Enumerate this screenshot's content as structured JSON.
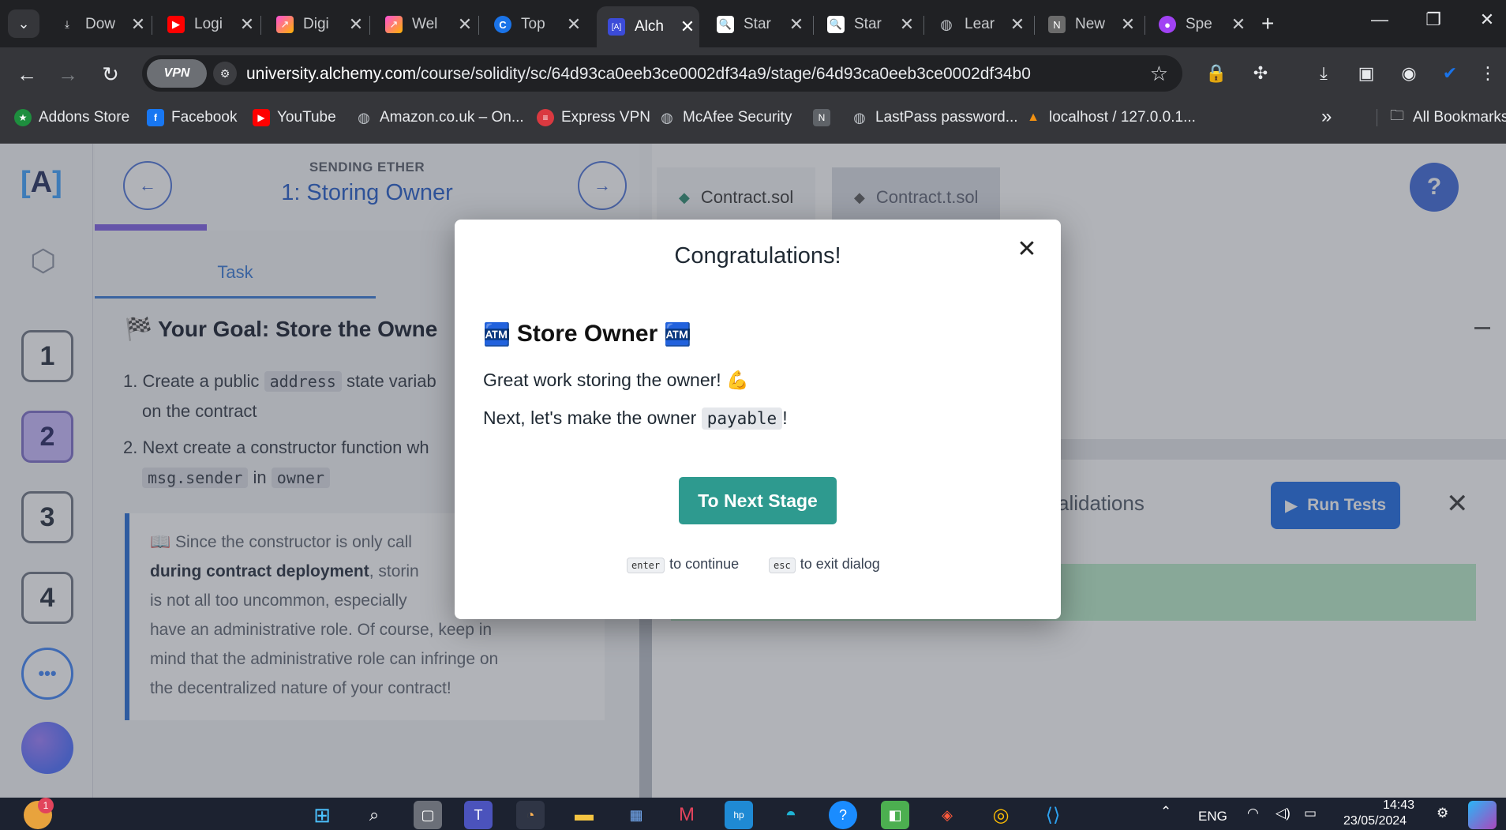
{
  "tabs": [
    {
      "label": "Dow",
      "icon": "download-icon",
      "color": "#5f6368"
    },
    {
      "label": "Logi",
      "icon": "youtube-icon",
      "color": "#ff0000"
    },
    {
      "label": "Digi",
      "icon": "chart-icon",
      "color": "#e040fb"
    },
    {
      "label": "Wel",
      "icon": "chart-icon",
      "color": "#e040fb"
    },
    {
      "label": "Top",
      "icon": "c-icon",
      "color": "#1a73e8"
    },
    {
      "label": "Alch",
      "icon": "alchemy-icon",
      "color": "#3b4bd8",
      "active": true
    },
    {
      "label": "Star",
      "icon": "magnifier-icon",
      "color": "#ffffff"
    },
    {
      "label": "Star",
      "icon": "magnifier-icon",
      "color": "#ffffff"
    },
    {
      "label": "Lear",
      "icon": "globe-icon",
      "color": "#9aa0a6"
    },
    {
      "label": "New",
      "icon": "n-icon",
      "color": "#6b6b6b"
    },
    {
      "label": "Spe",
      "icon": "speech-icon",
      "color": "#a142f4"
    }
  ],
  "toolbar": {
    "vpn_label": "VPN",
    "url_domain": "university.alchemy.com",
    "url_path": "/course/solidity/sc/64d93ca0eeb3ce0002df34a9/stage/64d93ca0eeb3ce0002df34b0"
  },
  "bookmarks": [
    {
      "label": "Addons Store",
      "icon": "addons-icon",
      "color": "#1e8e3e"
    },
    {
      "label": "Facebook",
      "icon": "facebook-icon",
      "color": "#1877f2"
    },
    {
      "label": "YouTube",
      "icon": "youtube-icon",
      "color": "#ff0000"
    },
    {
      "label": "Amazon.co.uk – On...",
      "icon": "globe-icon",
      "color": "#5f6368"
    },
    {
      "label": "Express VPN",
      "icon": "expressvpn-icon",
      "color": "#da3940"
    },
    {
      "label": "McAfee Security",
      "icon": "globe-icon",
      "color": "#5f6368"
    },
    {
      "label": "N",
      "icon": "n-icon",
      "color": "#5f6368"
    },
    {
      "label": "LastPass password...",
      "icon": "globe-icon",
      "color": "#5f6368"
    },
    {
      "label": "localhost / 127.0.0.1...",
      "icon": "phpmyadmin-icon",
      "color": "#f29111"
    }
  ],
  "bookmarks_more": "»",
  "all_bookmarks": "All Bookmarks",
  "lesson": {
    "kicker": "SENDING ETHER",
    "title": "1: Storing Owner",
    "task_tab": "Task",
    "goal": "🏁 Your Goal: Store the Owne",
    "item1_pre": "1. Create a public",
    "item1_code": "address",
    "item1_post": "state variab",
    "item1_cont": "on the contract",
    "item2_pre": "2. Next create a constructor function wh",
    "item2_code1": "msg.sender",
    "item2_mid": "in",
    "item2_code2": "owner",
    "callout_l1": "📖 Since the constructor is only call",
    "callout_l2_bold": "during contract deployment",
    "callout_l2_rest": ", storin",
    "callout_l3": "is not all too uncommon, especially",
    "callout_l4": "have an administrative role. Of course, keep in",
    "callout_l5": "mind that the administrative role can infringe on",
    "callout_l6": "the decentralized nature of your contract!"
  },
  "steps": [
    "1",
    "2",
    "3",
    "4"
  ],
  "current_step": "2",
  "more_label": "•••",
  "editor": {
    "file_tabs": [
      "Contract.sol",
      "Contract.t.sol"
    ],
    "validations": "alidations",
    "run_tests": "Run Tests",
    "help": "?"
  },
  "modal": {
    "title": "Congratulations!",
    "achievement": "Store Owner",
    "achievement_icon": "🏧",
    "line1": "Great work storing the owner! 💪",
    "line2_pre": "Next, let's make the owner",
    "line2_code": "payable",
    "line2_post": "!",
    "next_button": "To Next Stage",
    "hint_enter_key": "enter",
    "hint_enter_text": "to continue",
    "hint_esc_key": "esc",
    "hint_esc_text": "to exit dialog"
  },
  "taskbar": {
    "lang": "ENG",
    "time": "14:43",
    "date": "23/05/2024",
    "notification_count": "1"
  }
}
